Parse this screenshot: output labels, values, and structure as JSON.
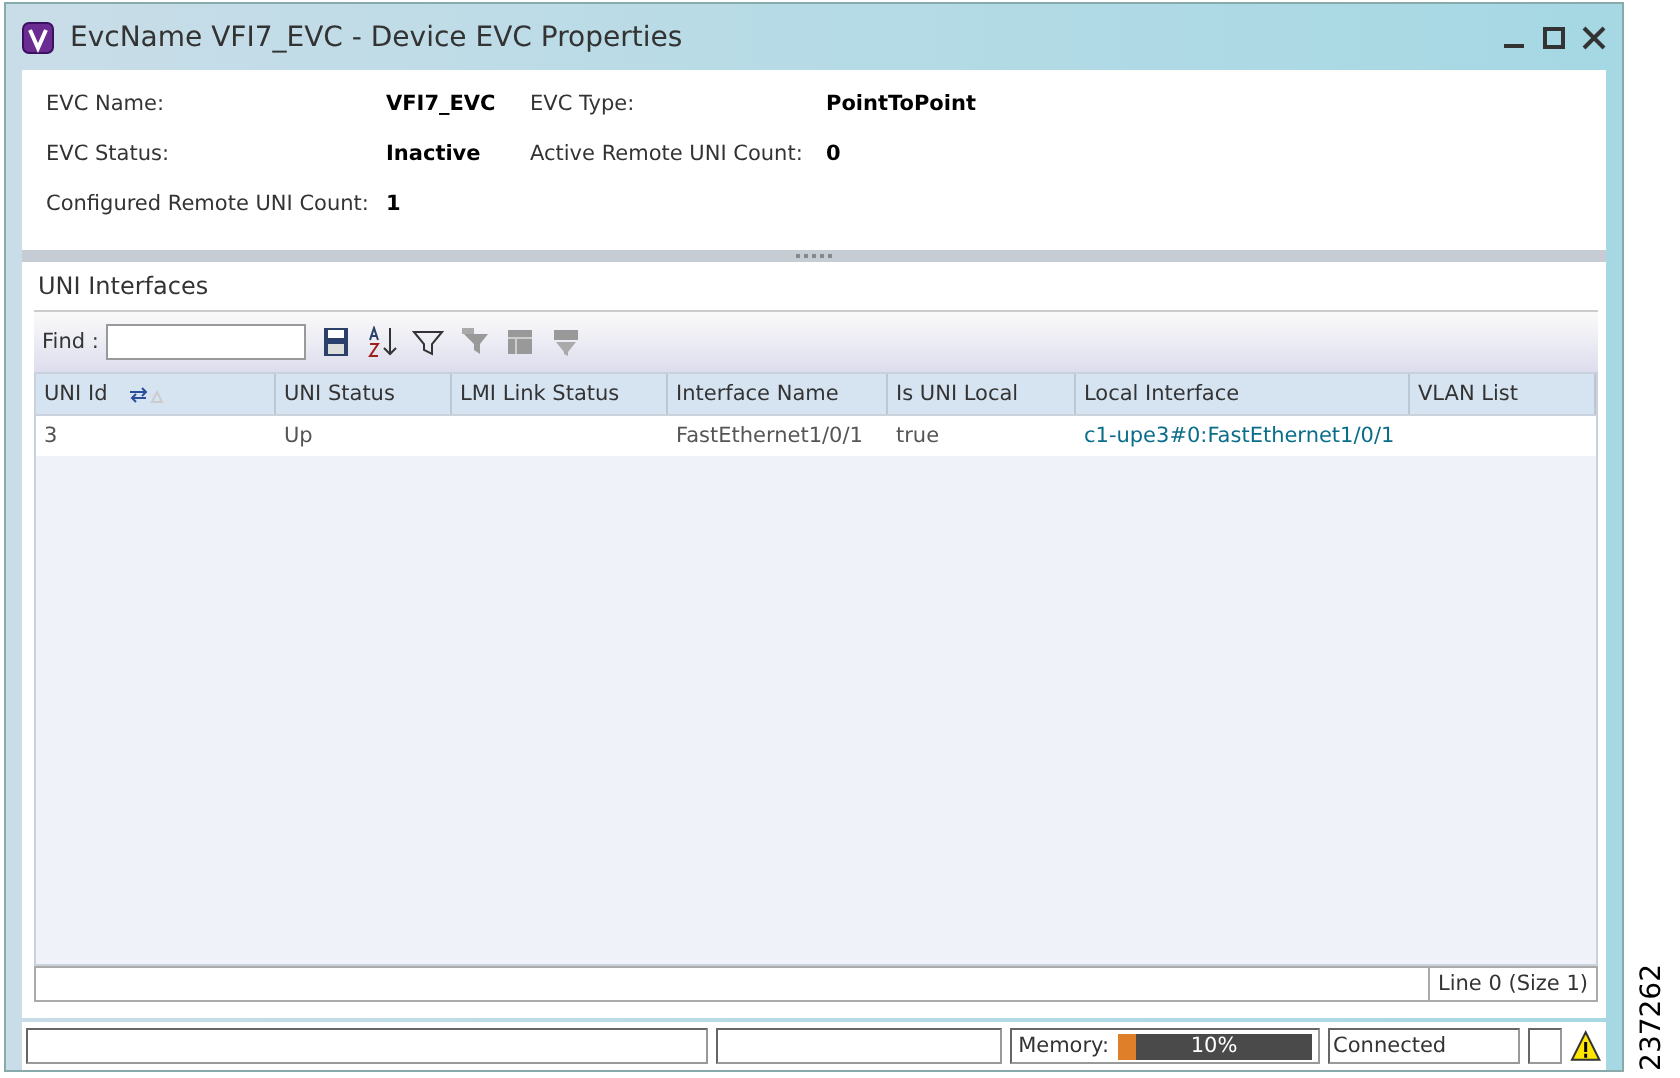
{
  "window": {
    "title": "EvcName VFI7_EVC - Device EVC Properties"
  },
  "properties": [
    {
      "label": "EVC Name:",
      "value": "VFI7_EVC"
    },
    {
      "label": "EVC Type:",
      "value": "PointToPoint"
    },
    {
      "label": "EVC Status:",
      "value": "Inactive"
    },
    {
      "label": "Active Remote UNI Count:",
      "value": "0"
    },
    {
      "label": "Configured Remote UNI Count:",
      "value": "1"
    }
  ],
  "section": {
    "title": "UNI Interfaces",
    "find_label": "Find :"
  },
  "table": {
    "columns": [
      "UNI Id",
      "UNI Status",
      "LMI Link Status",
      "Interface Name",
      "Is UNI Local",
      "Local Interface",
      "VLAN List"
    ],
    "rows": [
      {
        "cells": [
          "3",
          "Up",
          "",
          "FastEthernet1/0/1",
          "true",
          "c1-upe3#0:FastEthernet1/0/1",
          ""
        ]
      }
    ],
    "footer": "Line 0 (Size 1)"
  },
  "status_bar": {
    "memory_label": "Memory:",
    "memory": {
      "level": 0.1,
      "reading": "10%"
    },
    "connection": "Connected"
  },
  "figure_number": "237262"
}
